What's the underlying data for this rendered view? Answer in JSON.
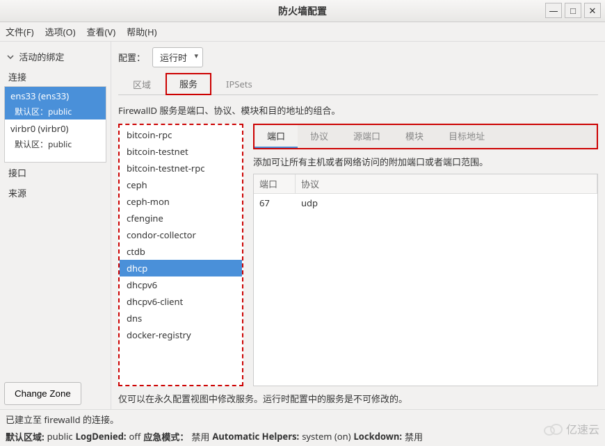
{
  "window": {
    "title": "防火墙配置",
    "minimize": "—",
    "maximize": "□",
    "close": "✕"
  },
  "menu": {
    "file": "文件(F)",
    "options": "选项(O)",
    "view": "查看(V)",
    "help": "帮助(H)"
  },
  "left": {
    "header": "活动的绑定",
    "sec_conn": "连接",
    "sec_iface": "接口",
    "sec_source": "来源",
    "items": [
      {
        "name": "ens33 (ens33)",
        "zone": "默认区：public",
        "selected": true
      },
      {
        "name": "virbr0 (virbr0)",
        "zone": "默认区：public",
        "selected": false
      }
    ],
    "change_zone": "Change Zone"
  },
  "config": {
    "label": "配置：",
    "value": "运行时"
  },
  "tabs1": {
    "zones": "区域",
    "services": "服务",
    "ipsets": "IPSets",
    "active": "services"
  },
  "service_desc": "FirewallD 服务是端口、协议、模块和目的地址的组合。",
  "services": [
    "bitcoin-rpc",
    "bitcoin-testnet",
    "bitcoin-testnet-rpc",
    "ceph",
    "ceph-mon",
    "cfengine",
    "condor-collector",
    "ctdb",
    "dhcp",
    "dhcpv6",
    "dhcpv6-client",
    "dns",
    "docker-registry"
  ],
  "services_selected": "dhcp",
  "tabs2": {
    "ports": "端口",
    "protocols": "协议",
    "source_ports": "源端口",
    "modules": "模块",
    "dest": "目标地址",
    "active": "ports"
  },
  "ports_desc": "添加可让所有主机或者网络访问的附加端口或者端口范围。",
  "port_table": {
    "headers": {
      "port": "端口",
      "protocol": "协议"
    },
    "rows": [
      {
        "port": "67",
        "protocol": "udp"
      }
    ]
  },
  "footnote": "仅可以在永久配置视图中修改服务。运行时配置中的服务是不可修改的。",
  "status1": "已建立至 firewalld 的连接。",
  "status2": {
    "default_zone_label": "默认区域:",
    "default_zone": "public",
    "logdenied_label": "LogDenied:",
    "logdenied": "off",
    "panic_label": "应急模式：",
    "panic": "禁用",
    "autohelpers_label": "Automatic Helpers:",
    "autohelpers": "system (on)",
    "lockdown_label": "Lockdown:",
    "lockdown": "禁用"
  },
  "watermark": "亿速云"
}
